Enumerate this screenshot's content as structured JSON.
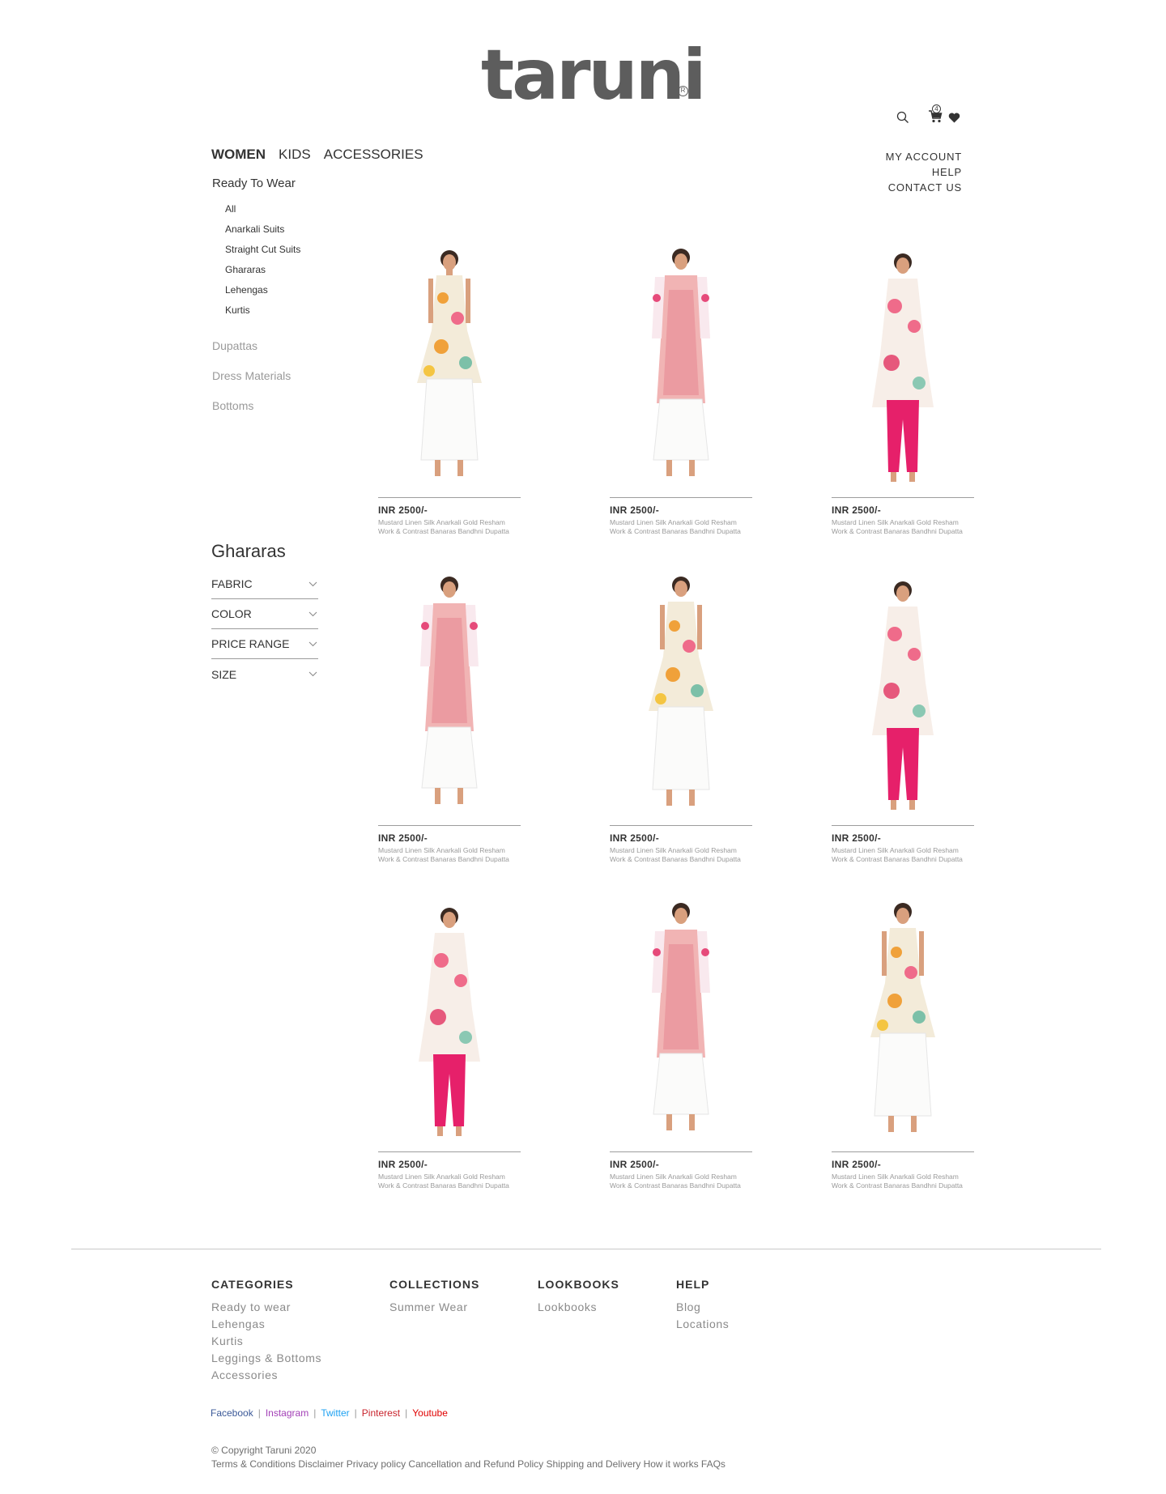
{
  "brand": {
    "name": "taruni",
    "registered": "R"
  },
  "header": {
    "cart_count": "4",
    "nav": [
      "WOMEN",
      "KIDS",
      "ACCESSORIES"
    ],
    "utility": [
      "MY ACCOUNT",
      "HELP",
      "CONTACT US"
    ]
  },
  "sidebar": {
    "category": "Ready To Wear",
    "subcategories": [
      "All",
      "Anarkali Suits",
      "Straight Cut Suits",
      "Ghararas",
      "Lehengas",
      "Kurtis"
    ],
    "other_categories": [
      "Dupattas",
      "Dress Materials",
      "Bottoms"
    ],
    "filter_title": "Ghararas",
    "filters": [
      "FABRIC",
      "COLOR",
      "PRICE RANGE",
      "SIZE"
    ]
  },
  "products": [
    {
      "price": "INR 2500/-",
      "desc1": "Mustard Linen Silk Anarkali Gold Resham",
      "desc2": "Work & Contrast Banaras Bandhni Dupatta"
    },
    {
      "price": "INR 2500/-",
      "desc1": "Mustard Linen Silk Anarkali Gold Resham",
      "desc2": "Work & Contrast Banaras Bandhni Dupatta"
    },
    {
      "price": "INR 2500/-",
      "desc1": "Mustard Linen Silk Anarkali Gold Resham",
      "desc2": "Work & Contrast Banaras Bandhni Dupatta"
    },
    {
      "price": "INR 2500/-",
      "desc1": "Mustard Linen Silk Anarkali Gold Resham",
      "desc2": "Work & Contrast Banaras Bandhni Dupatta"
    },
    {
      "price": "INR 2500/-",
      "desc1": "Mustard Linen Silk Anarkali Gold Resham",
      "desc2": "Work & Contrast Banaras Bandhni Dupatta"
    },
    {
      "price": "INR 2500/-",
      "desc1": "Mustard Linen Silk Anarkali Gold Resham",
      "desc2": "Work & Contrast Banaras Bandhni Dupatta"
    },
    {
      "price": "INR 2500/-",
      "desc1": "Mustard Linen Silk Anarkali Gold Resham",
      "desc2": "Work & Contrast Banaras Bandhni Dupatta"
    },
    {
      "price": "INR 2500/-",
      "desc1": "Mustard Linen Silk Anarkali Gold Resham",
      "desc2": "Work & Contrast Banaras Bandhni Dupatta"
    },
    {
      "price": "INR 2500/-",
      "desc1": "Mustard Linen Silk Anarkali Gold Resham",
      "desc2": "Work & Contrast Banaras Bandhni Dupatta"
    }
  ],
  "footer": {
    "columns": [
      {
        "title": "CATEGORIES",
        "items": [
          "Ready to wear",
          "Lehengas",
          "Kurtis",
          "Leggings & Bottoms",
          "Accessories"
        ]
      },
      {
        "title": "COLLECTIONS",
        "items": [
          "Summer Wear"
        ]
      },
      {
        "title": "LOOKBOOKS",
        "items": [
          "Lookbooks"
        ]
      },
      {
        "title": "HELP",
        "items": [
          "Blog",
          "Locations"
        ]
      }
    ],
    "social": [
      {
        "label": "Facebook",
        "color": "#3b5998"
      },
      {
        "label": "Instagram",
        "color": "#a23fb6"
      },
      {
        "label": "Twitter",
        "color": "#1da1f2"
      },
      {
        "label": "Pinterest",
        "color": "#c8232c"
      },
      {
        "label": "Youtube",
        "color": "#e00000"
      }
    ],
    "copyright": "© Copyright Taruni 2020",
    "links": "Terms & Conditions Disclaimer Privacy policy Cancellation and Refund Policy Shipping and Delivery How it works FAQs"
  }
}
